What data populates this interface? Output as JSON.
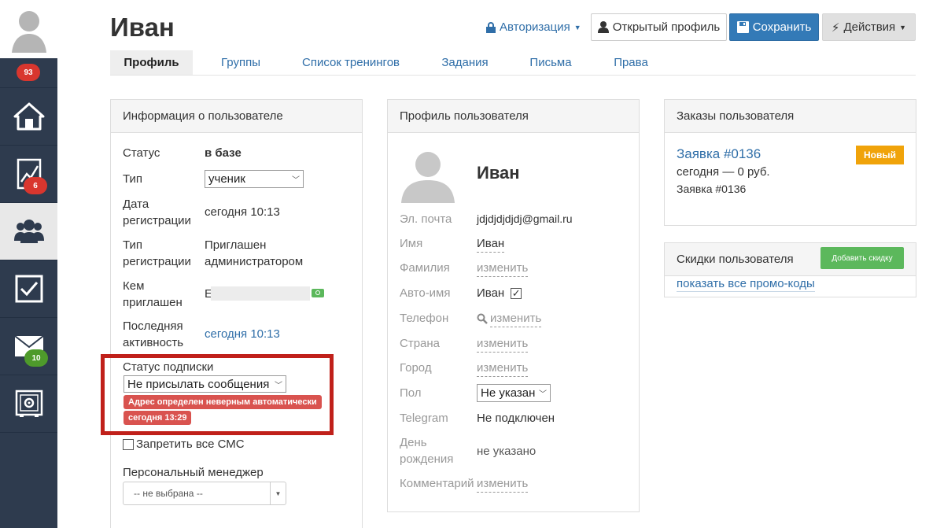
{
  "sidebar": {
    "items": [
      {
        "name": "avatar",
        "icon": "user-avatar-icon",
        "badge": "93"
      },
      {
        "name": "home",
        "icon": "home-icon"
      },
      {
        "name": "stats",
        "icon": "chart-icon",
        "badge": "6"
      },
      {
        "name": "users",
        "icon": "users-icon",
        "active": true
      },
      {
        "name": "tasks",
        "icon": "checkbox-icon"
      },
      {
        "name": "messages",
        "icon": "envelope-icon",
        "badge": "10"
      },
      {
        "name": "settings",
        "icon": "safe-gear-icon"
      }
    ]
  },
  "header": {
    "title": "Иван",
    "auth_label": "Авторизация",
    "open_profile_label": "Открытый профиль",
    "save_label": "Сохранить",
    "actions_label": "Действия"
  },
  "tabs": [
    {
      "label": "Профиль",
      "active": true
    },
    {
      "label": "Группы"
    },
    {
      "label": "Список тренингов"
    },
    {
      "label": "Задания"
    },
    {
      "label": "Письма"
    },
    {
      "label": "Права"
    }
  ],
  "user_info": {
    "title": "Информация о пользователе",
    "status_label": "Статус",
    "status_value": "в базе",
    "type_label": "Тип",
    "type_value": "ученик",
    "reg_date_label_1": "Дата",
    "reg_date_label_2": "регистрации",
    "reg_date_value": "сегодня 10:13",
    "reg_type_label_1": "Тип",
    "reg_type_label_2": "регистрации",
    "reg_type_value_1": "Приглашен",
    "reg_type_value_2": "администратором",
    "invited_by_label_1": "Кем",
    "invited_by_label_2": "приглашен",
    "invited_by_value": "Е",
    "last_activity_label_1": "Последняя",
    "last_activity_label_2": "активность",
    "last_activity_value": "сегодня 10:13",
    "subscription_label": "Статус подписки",
    "subscription_value": "Не присылать сообщения",
    "subscription_tag": "Адрес определен неверным автоматически",
    "subscription_time": "сегодня 13:29",
    "sms_label": "Запретить все СМС",
    "manager_label": "Персональный менеджер",
    "manager_value": "-- не выбрана --"
  },
  "profile": {
    "title": "Профиль пользователя",
    "name": "Иван",
    "email_label": "Эл. почта",
    "email_value": "jdjdjdjdjdj@gmail.ru",
    "first_name_label": "Имя",
    "first_name_value": "Иван",
    "last_name_label": "Фамилия",
    "last_name_value": "изменить",
    "auto_name_label": "Авто-имя",
    "auto_name_value": "Иван",
    "phone_label": "Телефон",
    "phone_value": "изменить",
    "country_label": "Страна",
    "country_value": "изменить",
    "city_label": "Город",
    "city_value": "изменить",
    "gender_label": "Пол",
    "gender_value": "Не указан",
    "telegram_label": "Telegram",
    "telegram_value": "Не подключен",
    "birthday_label_1": "День",
    "birthday_label_2": "рождения",
    "birthday_value": "не указано",
    "comment_label": "Комментарий",
    "comment_value": "изменить"
  },
  "orders": {
    "title": "Заказы пользователя",
    "order_link": "Заявка #0136",
    "order_badge": "Новый",
    "order_sum": "сегодня — 0 руб.",
    "order_name": "Заявка #0136"
  },
  "discounts": {
    "title": "Скидки пользователя",
    "add_button": "Добавить скидку",
    "promo_link": "показать все промо-коды"
  },
  "colors": {
    "sidebar": "#2e3b4e",
    "link": "#2f6ea8",
    "primary": "#337ab7",
    "danger": "#d9534f",
    "highlight": "#c0201a",
    "warning": "#f0a30a",
    "success": "#5cb85c"
  }
}
